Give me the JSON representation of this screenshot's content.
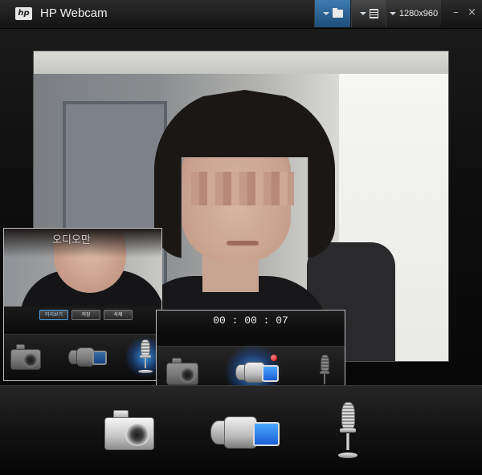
{
  "window": {
    "logo_text": "hp",
    "title": "HP Webcam"
  },
  "toolbar": {
    "folder_icon": "folder-icon",
    "gallery_icon": "gallery-icon",
    "resolution": "1280x960",
    "minimize": "–",
    "close": "×"
  },
  "audio_panel": {
    "title": "오디오만",
    "buttons": [
      "미리보기",
      "저장",
      "삭제"
    ],
    "modes": [
      "camera-icon",
      "video-camera-icon",
      "microphone-icon"
    ],
    "selected_mode": "microphone-icon"
  },
  "video_panel": {
    "timer": "00 : 00 : 07",
    "modes": [
      "camera-icon",
      "video-camera-icon",
      "microphone-icon"
    ],
    "selected_mode": "video-camera-icon",
    "recording_indicator": "rec-dot-icon"
  },
  "dock": {
    "modes": [
      "camera-icon",
      "video-camera-icon",
      "microphone-icon"
    ]
  },
  "colors": {
    "accent": "#3d7bb0",
    "highlight_glow": "#3ca0ff",
    "record_red": "#d40000"
  }
}
